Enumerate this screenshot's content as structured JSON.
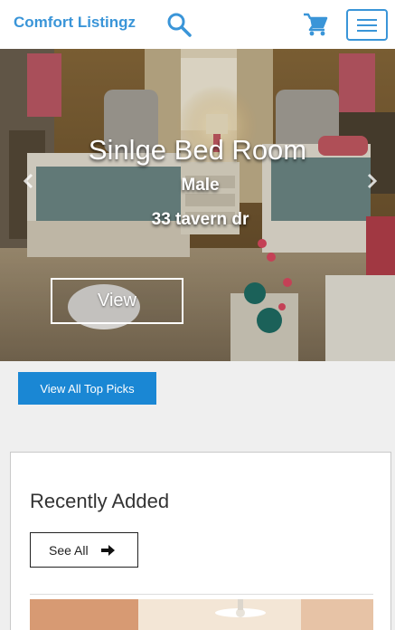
{
  "navbar": {
    "brand": "Comfort Listingz",
    "icons": {
      "search": "search-icon",
      "cart": "cart-icon",
      "menu": "hamburger-menu-icon"
    },
    "accent_color": "#3a95d8"
  },
  "hero": {
    "title": "Sinlge Bed Room",
    "gender": "Male",
    "address": "33 tavern dr",
    "view_label": "View",
    "icons": {
      "prev": "chevron-left-icon",
      "next": "chevron-right-icon"
    }
  },
  "top_picks": {
    "label": "View All Top Picks",
    "color": "#1a87d4"
  },
  "recent": {
    "title": "Recently Added",
    "see_all_label": "See All",
    "see_all_icon": "arrow-right-icon"
  }
}
